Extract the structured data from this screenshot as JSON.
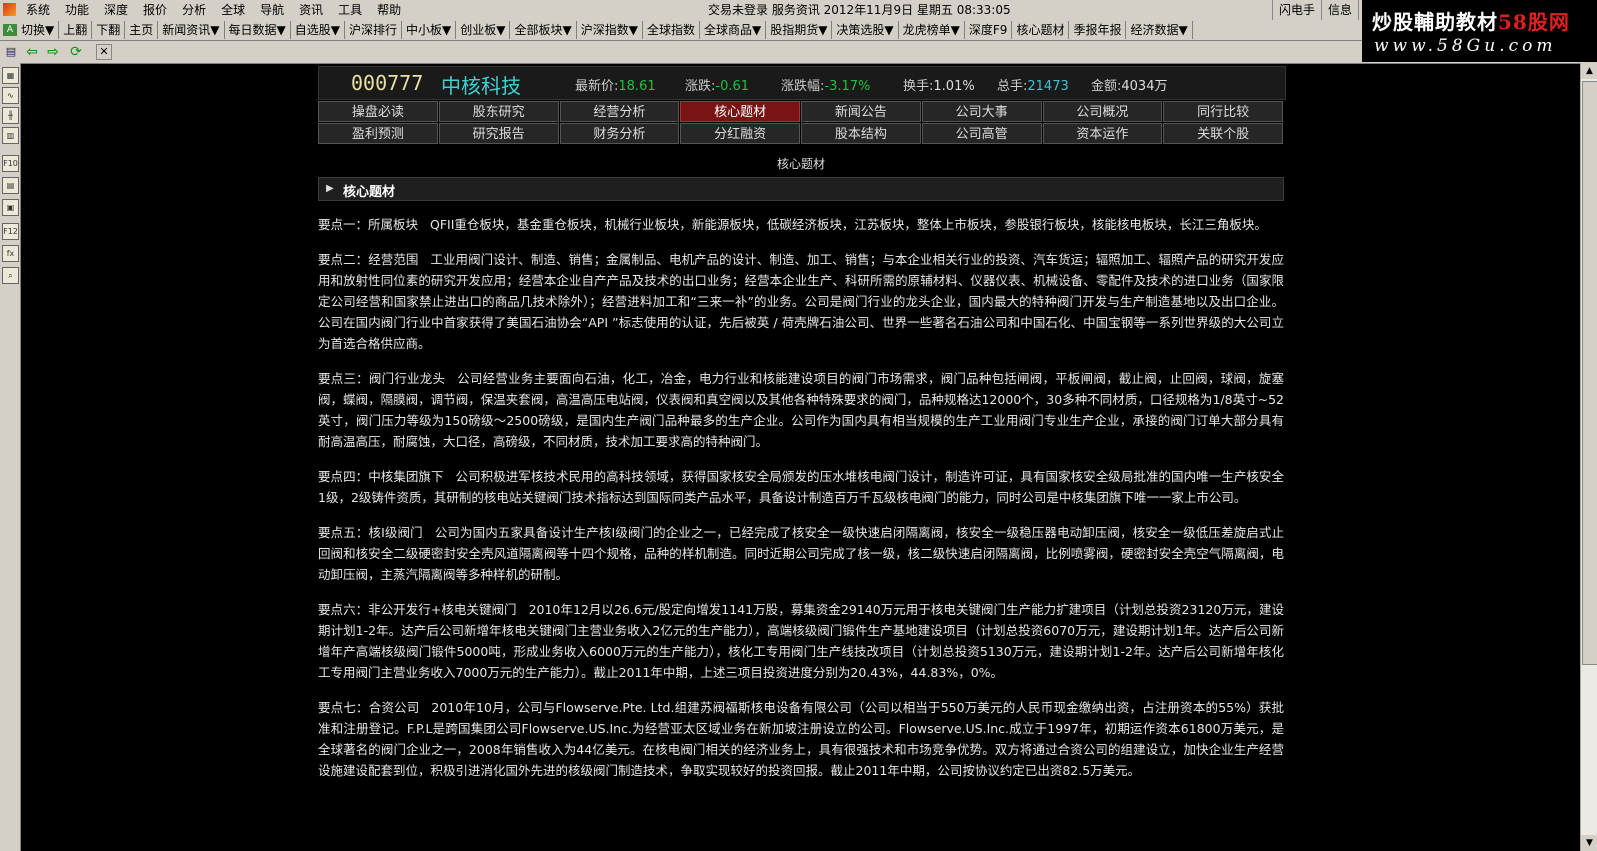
{
  "menubar": {
    "items": [
      "系统",
      "功能",
      "深度",
      "报价",
      "分析",
      "全球",
      "导航",
      "资讯",
      "工具",
      "帮助"
    ],
    "status": "交易未登录   服务资讯  2012年11月9日  星期五  08:33:05",
    "right_items": [
      "闪电手",
      "信息",
      "行"
    ]
  },
  "watermark": {
    "line1_a": "炒股輔助教材",
    "line1_b": "58",
    "line1_c": "股网",
    "line2": "www.58Gu.com"
  },
  "toolbar": {
    "items": [
      "切换▼",
      "上翻",
      "下翻",
      "主页",
      "新闻资讯▼",
      "每日数据▼",
      "自选股▼",
      "沪深排行",
      "中小板▼",
      "创业板▼",
      "全部板块▼",
      "沪深指数▼",
      "全球指数",
      "全球商品▼",
      "股指期货▼",
      "决策选股▼",
      "龙虎榜单▼",
      "深度F9",
      "核心题材",
      "季报年报",
      "经济数据▼"
    ]
  },
  "stock": {
    "code": "000777",
    "name": "中核科技",
    "price_label": "最新价:",
    "price": "18.61",
    "change_label": "涨跌:",
    "change": "-0.61",
    "pct_label": "涨跌幅:",
    "pct": "-3.17%",
    "turnover_label": "换手:",
    "turnover": "1.01%",
    "volume_label": "总手:",
    "volume": "21473",
    "amount_label": "金额:",
    "amount": "4034万"
  },
  "tabs": {
    "row1": [
      "操盘必读",
      "股东研究",
      "经营分析",
      "核心题材",
      "新闻公告",
      "公司大事",
      "公司概况",
      "同行比较"
    ],
    "row2": [
      "盈利预测",
      "研究报告",
      "财务分析",
      "分红融资",
      "股本结构",
      "公司高管",
      "资本运作",
      "关联个股"
    ],
    "active": "核心题材"
  },
  "page": {
    "subtitle": "核心题材",
    "section_title": "核心题材"
  },
  "points": [
    {
      "label": "要点一：所属板块",
      "text": "QFII重仓板块，基金重仓板块，机械行业板块，新能源板块，低碳经济板块，江苏板块，整体上市板块，参股银行板块，核能核电板块，长江三角板块。"
    },
    {
      "label": "要点二：经营范围",
      "text": "工业用阀门设计、制造、销售；金属制品、电机产品的设计、制造、加工、销售；与本企业相关行业的投资、汽车货运；辐照加工、辐照产品的研究开发应用和放射性同位素的研究开发应用；经营本企业自产产品及技术的出口业务；经营本企业生产、科研所需的原辅材料、仪器仪表、机械设备、零配件及技术的进口业务（国家限定公司经营和国家禁止进出口的商品几技术除外）；经营进料加工和“三来一补”的业务。公司是阀门行业的龙头企业，国内最大的特种阀门开发与生产制造基地以及出口企业。公司在国内阀门行业中首家获得了美国石油协会“API ”标志使用的认证，先后被英 / 荷壳牌石油公司、世界一些著名石油公司和中国石化、中国宝钢等一系列世界级的大公司立为首选合格供应商。"
    },
    {
      "label": "要点三：阀门行业龙头",
      "text": "公司经营业务主要面向石油，化工，冶金，电力行业和核能建设项目的阀门市场需求，阀门品种包括闸阀，平板闸阀，截止阀，止回阀，球阀，旋塞阀，蝶阀，隔膜阀，调节阀，保温夹套阀，高温高压电站阀，仪表阀和真空阀以及其他各种特殊要求的阀门，品种规格达12000个，30多种不同材质，口径规格为1/8英寸~52英寸，阀门压力等级为150磅级～2500磅级，是国内生产阀门品种最多的生产企业。公司作为国内具有相当规模的生产工业用阀门专业生产企业，承接的阀门订单大部分具有耐高温高压，耐腐蚀，大口径，高磅级，不同材质，技术加工要求高的特种阀门。"
    },
    {
      "label": "要点四：中核集团旗下",
      "text": "公司积极进军核技术民用的高科技领域，获得国家核安全局颁发的压水堆核电阀门设计，制造许可证，具有国家核安全级局批准的国内唯一生产核安全1级，2级铸件资质，其研制的核电站关键阀门技术指标达到国际同类产品水平，具备设计制造百万千瓦级核电阀门的能力，同时公司是中核集团旗下唯一一家上市公司。"
    },
    {
      "label": "要点五：核I级阀门",
      "text": "公司为国内五家具备设计生产核I级阀门的企业之一，已经完成了核安全一级快速启闭隔离阀，核安全一级稳压器电动卸压阀，核安全一级低压差旋启式止回阀和核安全二级硬密封安全壳风道隔离阀等十四个规格，品种的样机制造。同时近期公司完成了核一级，核二级快速启闭隔离阀，比例喷雾阀，硬密封安全壳空气隔离阀，电动卸压阀，主蒸汽隔离阀等多种样机的研制。"
    },
    {
      "label": "要点六：非公开发行+核电关键阀门",
      "text": "2010年12月以26.6元/股定向增发1141万股，募集资金29140万元用于核电关键阀门生产能力扩建项目（计划总投资23120万元，建设期计划1-2年。达产后公司新增年核电关键阀门主营业务收入2亿元的生产能力），高端核级阀门锻件生产基地建设项目（计划总投资6070万元，建设期计划1年。达产后公司新增年产高端核级阀门锻件5000吨，形成业务收入6000万元的生产能力），核化工专用阀门生产线技改项目（计划总投资5130万元，建设期计划1-2年。达产后公司新增年核化工专用阀门主营业务收入7000万元的生产能力）。截止2011年中期，上述三项目投资进度分别为20.43%，44.83%，0%。"
    },
    {
      "label": "要点七：合资公司",
      "text": "2010年10月，公司与Flowserve.Pte. Ltd.组建苏阀福斯核电设备有限公司（公司以相当于550万美元的人民币现金缴纳出资，占注册资本的55%）获批准和注册登记。F.P.L是跨国集团公司Flowserve.US.Inc.为经营亚太区域业务在新加坡注册设立的公司。Flowserve.US.Inc.成立于1997年，初期运作资本61800万美元，是全球著名的阀门企业之一，2008年销售收入为44亿美元。在核电阀门相关的经济业务上，具有很强技术和市场竞争优势。双方将通过合资公司的组建设立，加快企业生产经营设施建设配套到位，积极引进消化国外先进的核级阀门制造技术，争取实现较好的投资回报。截止2011年中期，公司按协议约定已出资82.5万美元。"
    }
  ]
}
